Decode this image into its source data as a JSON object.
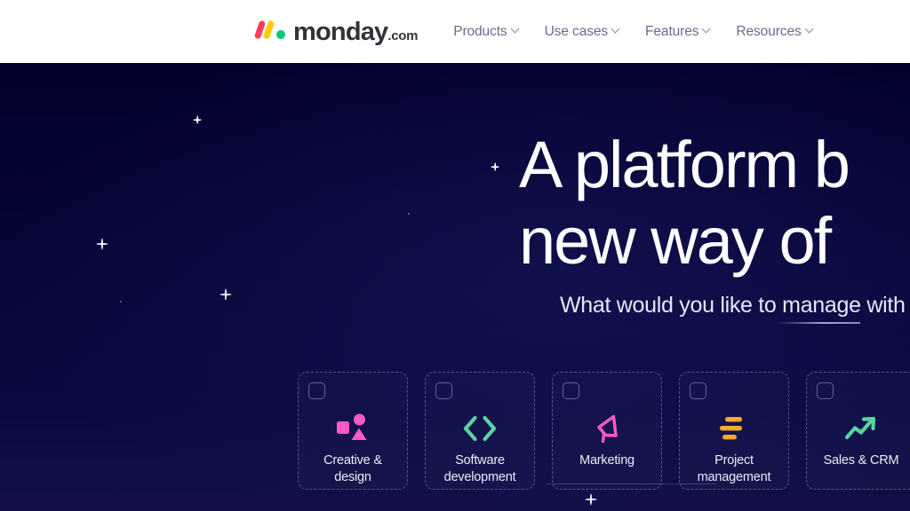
{
  "brand": {
    "logo_word": "monday",
    "logo_tld": ".com",
    "logo_colors": {
      "bar1": "#ff3d57",
      "bar2": "#ffcb00",
      "dot": "#00ca72"
    }
  },
  "nav": {
    "items": [
      {
        "label": "Products",
        "icon": "chevron-down-icon"
      },
      {
        "label": "Use cases",
        "icon": "chevron-down-icon"
      },
      {
        "label": "Features",
        "icon": "chevron-down-icon"
      },
      {
        "label": "Resources",
        "icon": "chevron-down-icon"
      }
    ]
  },
  "hero": {
    "title_line1": "A platform b",
    "title_line2": "new way of",
    "subtitle": "What would you like to manage with",
    "background_color": "#05063a",
    "text_color": "#ffffff"
  },
  "cards": [
    {
      "label": "Creative & design",
      "icon": "shapes-icon",
      "icon_color": "#ff5ac4"
    },
    {
      "label": "Software development",
      "icon": "code-brackets-icon",
      "icon_color": "#5ad3a0"
    },
    {
      "label": "Marketing",
      "icon": "megaphone-icon",
      "icon_color": "#ff5ac4"
    },
    {
      "label": "Project management",
      "icon": "bars-list-icon",
      "icon_color": "#f5ab2e"
    },
    {
      "label": "Sales & CRM",
      "icon": "trend-up-arrow-icon",
      "icon_color": "#5ad3a0"
    }
  ]
}
